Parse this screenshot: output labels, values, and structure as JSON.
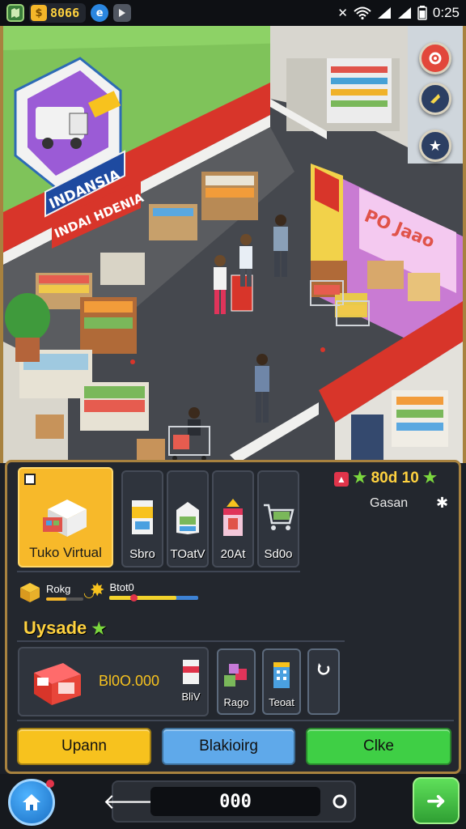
{
  "status_bar": {
    "coins": "8066",
    "time": "0:25",
    "icons": [
      "map-icon",
      "coin-icon",
      "e-icon",
      "play-icon",
      "mute-icon",
      "wifi-icon",
      "signal-icon",
      "signal-icon",
      "battery-icon"
    ]
  },
  "scene": {
    "billboard_text": "INDANSIA",
    "store_sign_left": "INDAI HDENIA",
    "store_sign_right": "PO Jaao",
    "side_buttons": [
      "settings-icon",
      "boost-icon",
      "star-icon"
    ]
  },
  "panel": {
    "products": [
      {
        "label": "Tuko Virtual",
        "selected": true
      },
      {
        "label": "Sbro"
      },
      {
        "label": "TOatV"
      },
      {
        "label": "20At"
      },
      {
        "label": "Sd0o"
      }
    ],
    "stars_value": "80d 10",
    "stars_caption": "Gasan",
    "meters": [
      {
        "label": "Rokg",
        "fill": 0.55,
        "color": "#f5b629"
      },
      {
        "label": "Btot0",
        "fill": 0.75,
        "color": "#f2d22c"
      }
    ],
    "section_title": "Uysade",
    "upgrade": {
      "price": "Bl0O.000",
      "items": [
        {
          "label": "BliV"
        },
        {
          "label": "Rago"
        },
        {
          "label": "Teoat"
        }
      ]
    },
    "buttons": {
      "upgrade": "Upann",
      "blocking": "Blakioirg",
      "click": "Clke"
    },
    "colors": {
      "yellow": "#f7c21e",
      "blue": "#5fa9ea",
      "green": "#3fcf45"
    }
  },
  "navbar": {
    "counter": "000"
  }
}
